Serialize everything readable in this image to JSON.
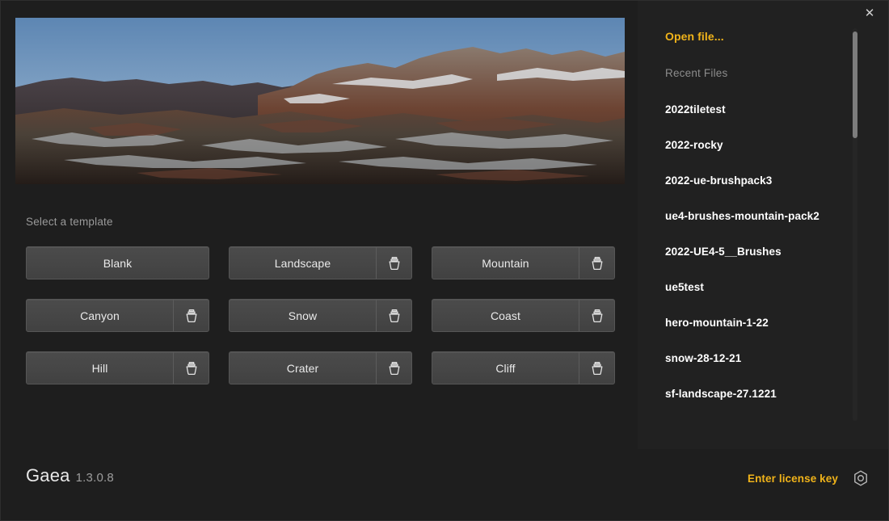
{
  "window": {
    "close_label": "✕"
  },
  "hero": {
    "alt": "terrain-render-preview",
    "sky_top": "#5c86b4",
    "sky_bottom": "#b9cddc",
    "rock_color": "#6b3a2c",
    "snow_color": "#d9dee2"
  },
  "templates": {
    "section_label": "Select a template",
    "icon_name": "terrain-primitive-icon",
    "items": [
      {
        "label": "Blank",
        "has_icon": false
      },
      {
        "label": "Landscape",
        "has_icon": true
      },
      {
        "label": "Mountain",
        "has_icon": true
      },
      {
        "label": "Canyon",
        "has_icon": true
      },
      {
        "label": "Snow",
        "has_icon": true
      },
      {
        "label": "Coast",
        "has_icon": true
      },
      {
        "label": "Hill",
        "has_icon": true
      },
      {
        "label": "Crater",
        "has_icon": true
      },
      {
        "label": "Cliff",
        "has_icon": true
      }
    ]
  },
  "files": {
    "open_file_label": "Open file...",
    "recent_heading": "Recent Files",
    "recent": [
      "2022tiletest",
      "2022-rocky",
      "2022-ue-brushpack3",
      "ue4-brushes-mountain-pack2",
      "2022-UE4-5__Brushes",
      "ue5test",
      "hero-mountain-1-22",
      "snow-28-12-21",
      "sf-landscape-27.1221"
    ]
  },
  "footer": {
    "brand_name": "Gaea",
    "version": "1.3.0.8",
    "license_label": "Enter license key",
    "settings_icon": "hex-settings-icon"
  },
  "colors": {
    "accent": "#f0b31a",
    "window_bg": "#1e1e1e",
    "panel_bg": "#212121",
    "button_bg": "#474747",
    "text_primary": "#ffffff",
    "text_muted": "#8c8c8c"
  }
}
